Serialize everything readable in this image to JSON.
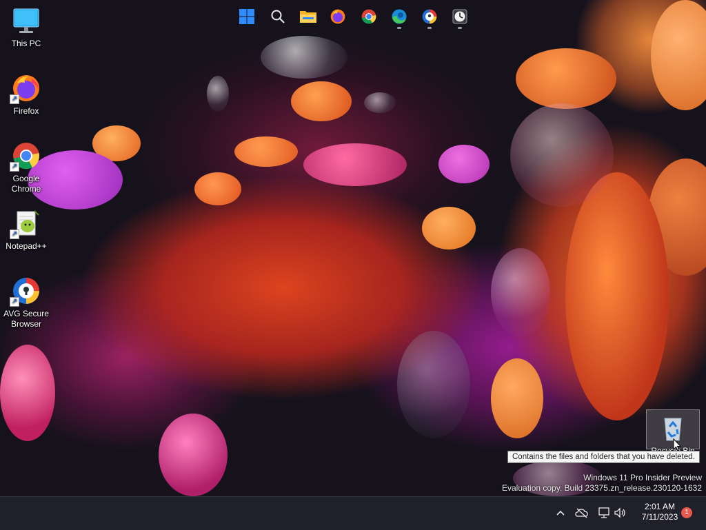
{
  "desktop": {
    "icons": [
      {
        "label": "This PC",
        "icon": "monitor-icon"
      },
      {
        "label": "Firefox",
        "icon": "firefox-icon"
      },
      {
        "label": "Google Chrome",
        "icon": "chrome-icon"
      },
      {
        "label": "Notepad++",
        "icon": "notepadpp-icon"
      },
      {
        "label": "AVG Secure Browser",
        "icon": "avg-browser-icon"
      }
    ],
    "recycle_bin": {
      "label": "Recycle Bin",
      "icon": "recycle-bin-icon"
    },
    "tooltip": "Contains the files and folders that you have deleted.",
    "watermark": {
      "line1": "Windows 11 Pro Insider Preview",
      "line2": "Evaluation copy. Build 23375.zn_release.230120-1632"
    }
  },
  "taskbar": {
    "apps": [
      {
        "name": "Start",
        "icon": "windows-start-icon",
        "running": false
      },
      {
        "name": "Search",
        "icon": "search-icon",
        "running": false
      },
      {
        "name": "File Explorer",
        "icon": "folder-icon",
        "running": false
      },
      {
        "name": "Firefox",
        "icon": "firefox-icon",
        "running": false
      },
      {
        "name": "Google Chrome",
        "icon": "chrome-icon",
        "running": false
      },
      {
        "name": "Microsoft Edge",
        "icon": "edge-icon",
        "running": true
      },
      {
        "name": "AVG Secure Browser",
        "icon": "avg-browser-icon",
        "running": true
      },
      {
        "name": "Clock app",
        "icon": "clock-app-icon",
        "running": true
      }
    ],
    "tray": {
      "time": "2:01 AM",
      "date": "7/11/2023",
      "notification_count": "1"
    }
  },
  "colors": {
    "taskbar_bg": "#20202a",
    "accent_blue": "#2f8cff",
    "notification_badge": "#e85a4f"
  }
}
